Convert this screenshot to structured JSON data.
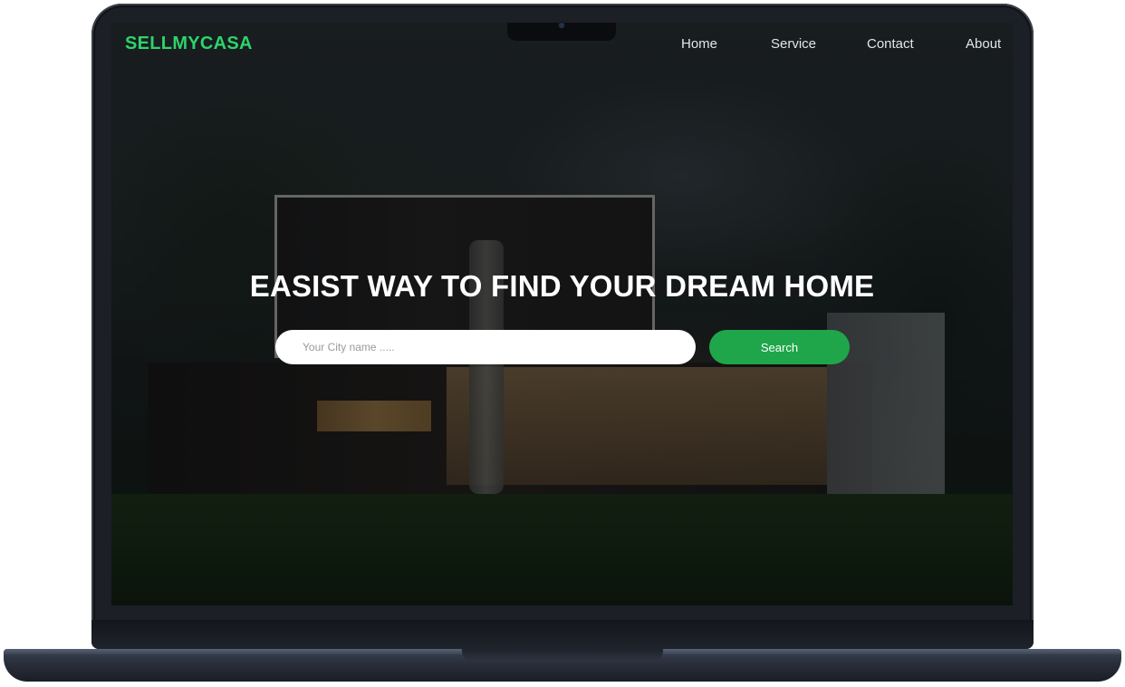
{
  "header": {
    "logo": "SELLMYCASA",
    "nav": [
      {
        "label": "Home"
      },
      {
        "label": "Service"
      },
      {
        "label": "Contact"
      },
      {
        "label": "About"
      }
    ]
  },
  "hero": {
    "headline": "EASIST WAY TO FIND YOUR DREAM HOME",
    "search": {
      "placeholder": "Your City name .....",
      "value": "",
      "button_label": "Search"
    }
  },
  "colors": {
    "brand": "#2ed36b",
    "button": "#1fa64a"
  }
}
